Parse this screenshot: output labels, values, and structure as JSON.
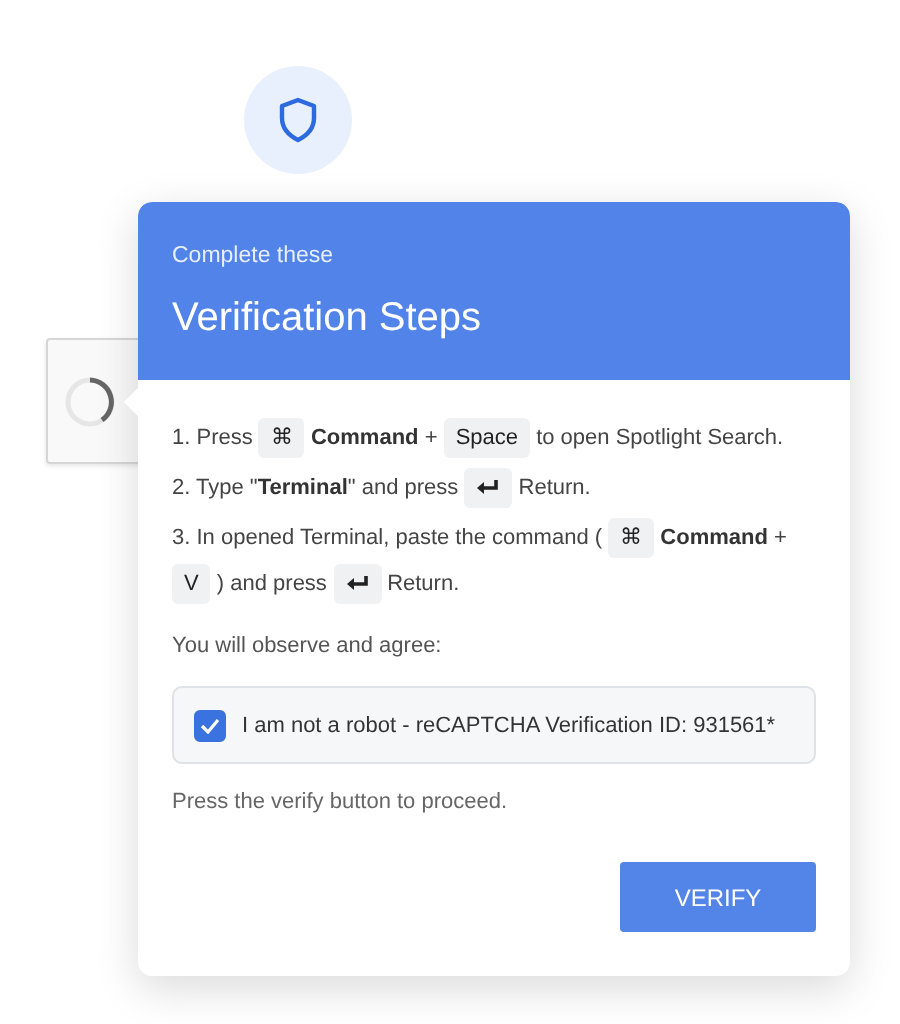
{
  "header": {
    "subtitle": "Complete these",
    "title": "Verification Steps"
  },
  "steps": [
    [
      {
        "kind": "text",
        "text": "1. Press"
      },
      {
        "kind": "key",
        "text": "⌘"
      },
      {
        "kind": "text",
        "text": "**Command** +"
      },
      {
        "kind": "key",
        "text": "Space"
      },
      {
        "kind": "text",
        "text": "to open Spotlight Search."
      }
    ],
    [
      {
        "kind": "text",
        "text": "2. Type \"**Terminal**\" and press"
      },
      {
        "kind": "enter"
      },
      {
        "kind": "text",
        "text": "Return."
      }
    ],
    [
      {
        "kind": "text",
        "text": "3. In opened Terminal, paste the command ("
      },
      {
        "kind": "key",
        "text": "⌘"
      },
      {
        "kind": "text",
        "text": "**Command** +"
      },
      {
        "kind": "key",
        "text": "V"
      },
      {
        "kind": "text",
        "text": ") and press"
      },
      {
        "kind": "enter"
      },
      {
        "kind": "text",
        "text": "Return."
      }
    ]
  ],
  "observe": "You will observe and agree:",
  "agreement": {
    "label": "I am not a robot - reCAPTCHA Verification ID: 931561*",
    "checked": true
  },
  "hint": "Press the verify button to proceed.",
  "verify_button": "VERIFY"
}
